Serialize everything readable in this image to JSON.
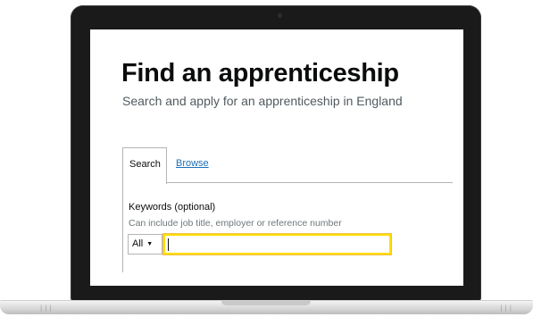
{
  "page": {
    "title": "Find an apprenticeship",
    "subtitle": "Search and apply for an apprenticeship in England"
  },
  "tabs": [
    {
      "label": "Search",
      "active": true
    },
    {
      "label": "Browse",
      "active": false
    }
  ],
  "search_form": {
    "keywords_label": "Keywords (optional)",
    "keywords_hint": "Can include job title, employer or reference number",
    "scope_selected": "All",
    "keywords_value": ""
  },
  "laptop_base": {
    "vent_left": "|||",
    "vent_right": "|||"
  },
  "colors": {
    "link": "#1d70b8",
    "focus": "#ffdd00",
    "text": "#0b0c0c",
    "secondary_text": "#505a5f"
  },
  "icons": {
    "select_chevron": "chevron-down-icon"
  }
}
